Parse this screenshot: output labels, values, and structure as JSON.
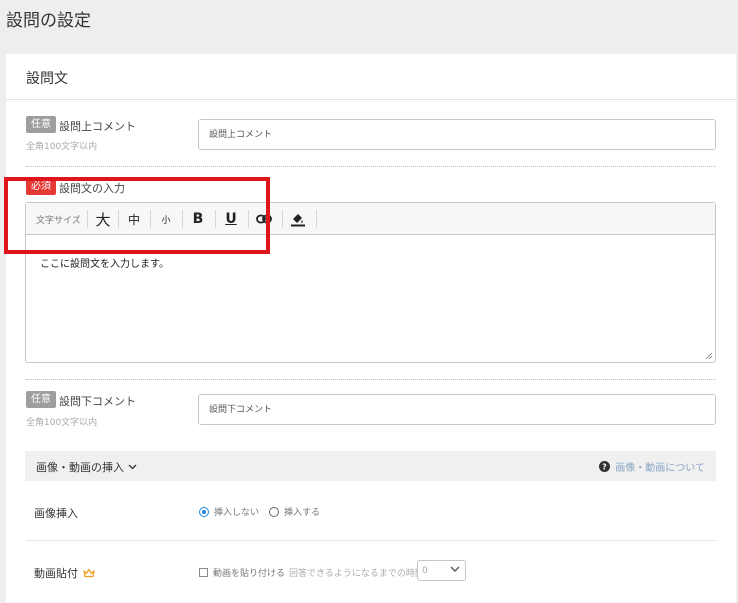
{
  "page": {
    "title": "設問の設定"
  },
  "question_section": {
    "title": "設問文",
    "top_comment": {
      "badge": "任意",
      "label": "設問上コメント",
      "hint": "全角100文字以内",
      "placeholder": "設問上コメント"
    },
    "question_text": {
      "badge": "必須",
      "label": "設問文の入力",
      "toolbar": {
        "font_size_label": "文字サイズ",
        "size_large": "大",
        "size_medium": "中",
        "size_small": "小",
        "bold": "B",
        "underline": "U"
      },
      "value": "ここに設問文を入力します。"
    },
    "bottom_comment": {
      "badge": "任意",
      "label": "設問下コメント",
      "hint": "全角100文字以内",
      "placeholder": "設問下コメント"
    }
  },
  "media": {
    "toggle_label": "画像・動画の挿入",
    "help_link": "画像・動画について",
    "image_insert": {
      "label": "画像挿入",
      "options": [
        "挿入しない",
        "挿入する"
      ],
      "selected": "挿入しない"
    },
    "video_embed": {
      "label": "動画貼付",
      "checkbox_label": "動画を貼り付ける",
      "wait_label": "回答できるようになるまでの時間",
      "wait_value": "0"
    }
  },
  "colors": {
    "required_badge": "#e53935",
    "optional_badge": "#9e9e9e",
    "highlight": "#e0151b",
    "radio_selected": "#1e88e5",
    "crown": "#f0a020"
  }
}
